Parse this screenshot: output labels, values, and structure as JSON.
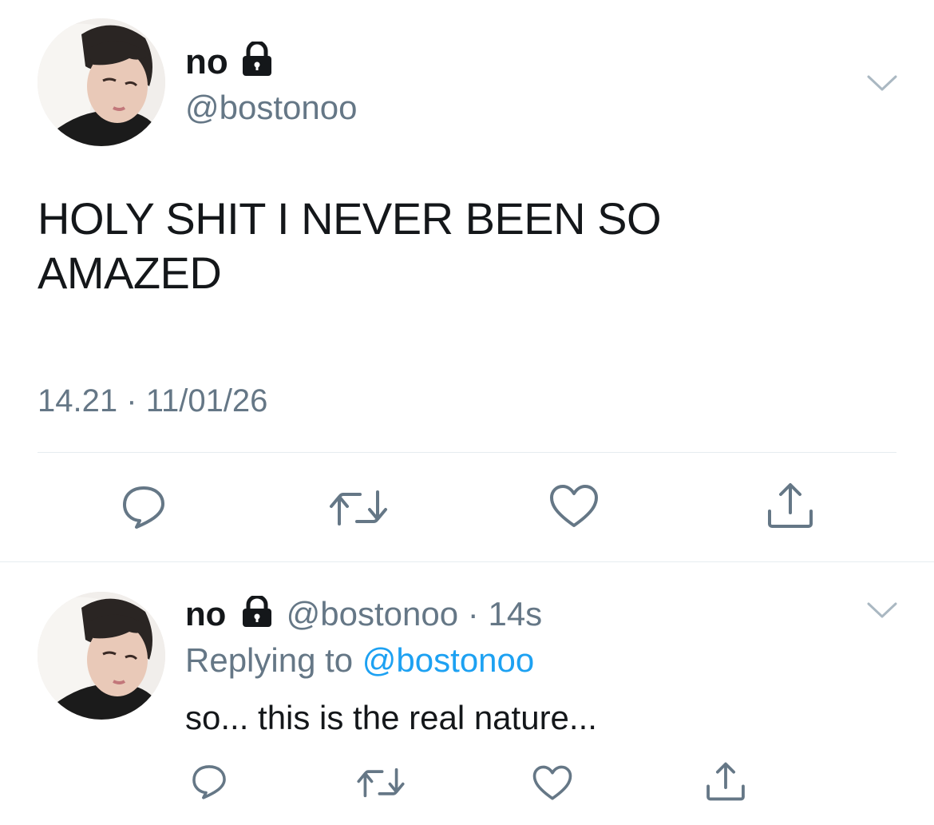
{
  "tweet": {
    "author_name": "no",
    "author_handle": "@bostonoo",
    "text": "HOLY SHIT I NEVER BEEN SO AMAZED",
    "time": "14.21",
    "separator": "·",
    "date": "11/01/26",
    "icons": {
      "lock": "lock-icon",
      "more": "chevron-down-icon",
      "reply": "reply-icon",
      "retweet": "retweet-icon",
      "like": "like-icon",
      "share": "share-icon"
    }
  },
  "reply": {
    "author_name": "no",
    "author_handle": "@bostonoo",
    "separator": "·",
    "age": "14s",
    "replying_prefix": "Replying to",
    "replying_to": "@bostonoo",
    "text": "so... this is the real nature..."
  },
  "colors": {
    "text": "#14171a",
    "secondary": "#657786",
    "link": "#1da1f2",
    "divider": "#e6ecf0",
    "icon": "#657786"
  }
}
